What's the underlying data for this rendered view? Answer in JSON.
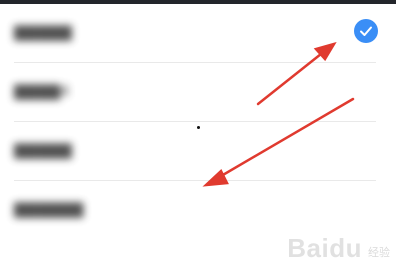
{
  "items": [
    {
      "label": "▇▇▇▇▇",
      "selected": true
    },
    {
      "label": "▇▇▇▇4",
      "selected": false
    },
    {
      "label": "▇▇▇▇▇",
      "selected": false
    },
    {
      "label": "▇▇▇▇▇▇",
      "selected": false
    }
  ],
  "watermark": {
    "brand": "Baidu",
    "sub": "经验"
  },
  "colors": {
    "accent": "#3a8ef6",
    "arrow": "#e03a2f"
  }
}
